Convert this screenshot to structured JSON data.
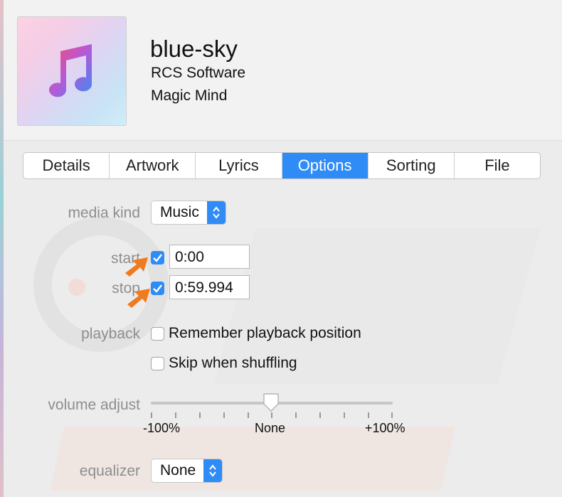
{
  "song": {
    "title": "blue-sky",
    "artist": "RCS Software",
    "album": "Magic Mind"
  },
  "tabs": [
    "Details",
    "Artwork",
    "Lyrics",
    "Options",
    "Sorting",
    "File"
  ],
  "active_tab": "Options",
  "options": {
    "media_kind_label": "media kind",
    "media_kind_value": "Music",
    "start_label": "start",
    "start_checked": true,
    "start_value": "0:00",
    "stop_label": "stop",
    "stop_checked": true,
    "stop_value": "0:59.994",
    "playback_label": "playback",
    "remember_position_label": "Remember playback position",
    "remember_position_checked": false,
    "skip_shuffling_label": "Skip when shuffling",
    "skip_shuffling_checked": false,
    "volume_label": "volume adjust",
    "volume_min_label": "-100%",
    "volume_mid_label": "None",
    "volume_max_label": "+100%",
    "volume_value_percent": 0,
    "equalizer_label": "equalizer",
    "equalizer_value": "None"
  },
  "colors": {
    "accent": "#2f8cf6",
    "annotation_arrow": "#f07a1e"
  },
  "icons": [
    "music-note-icon",
    "stepper-icon",
    "checkmark-icon",
    "slider-knob-icon",
    "annotation-arrow-icon"
  ]
}
